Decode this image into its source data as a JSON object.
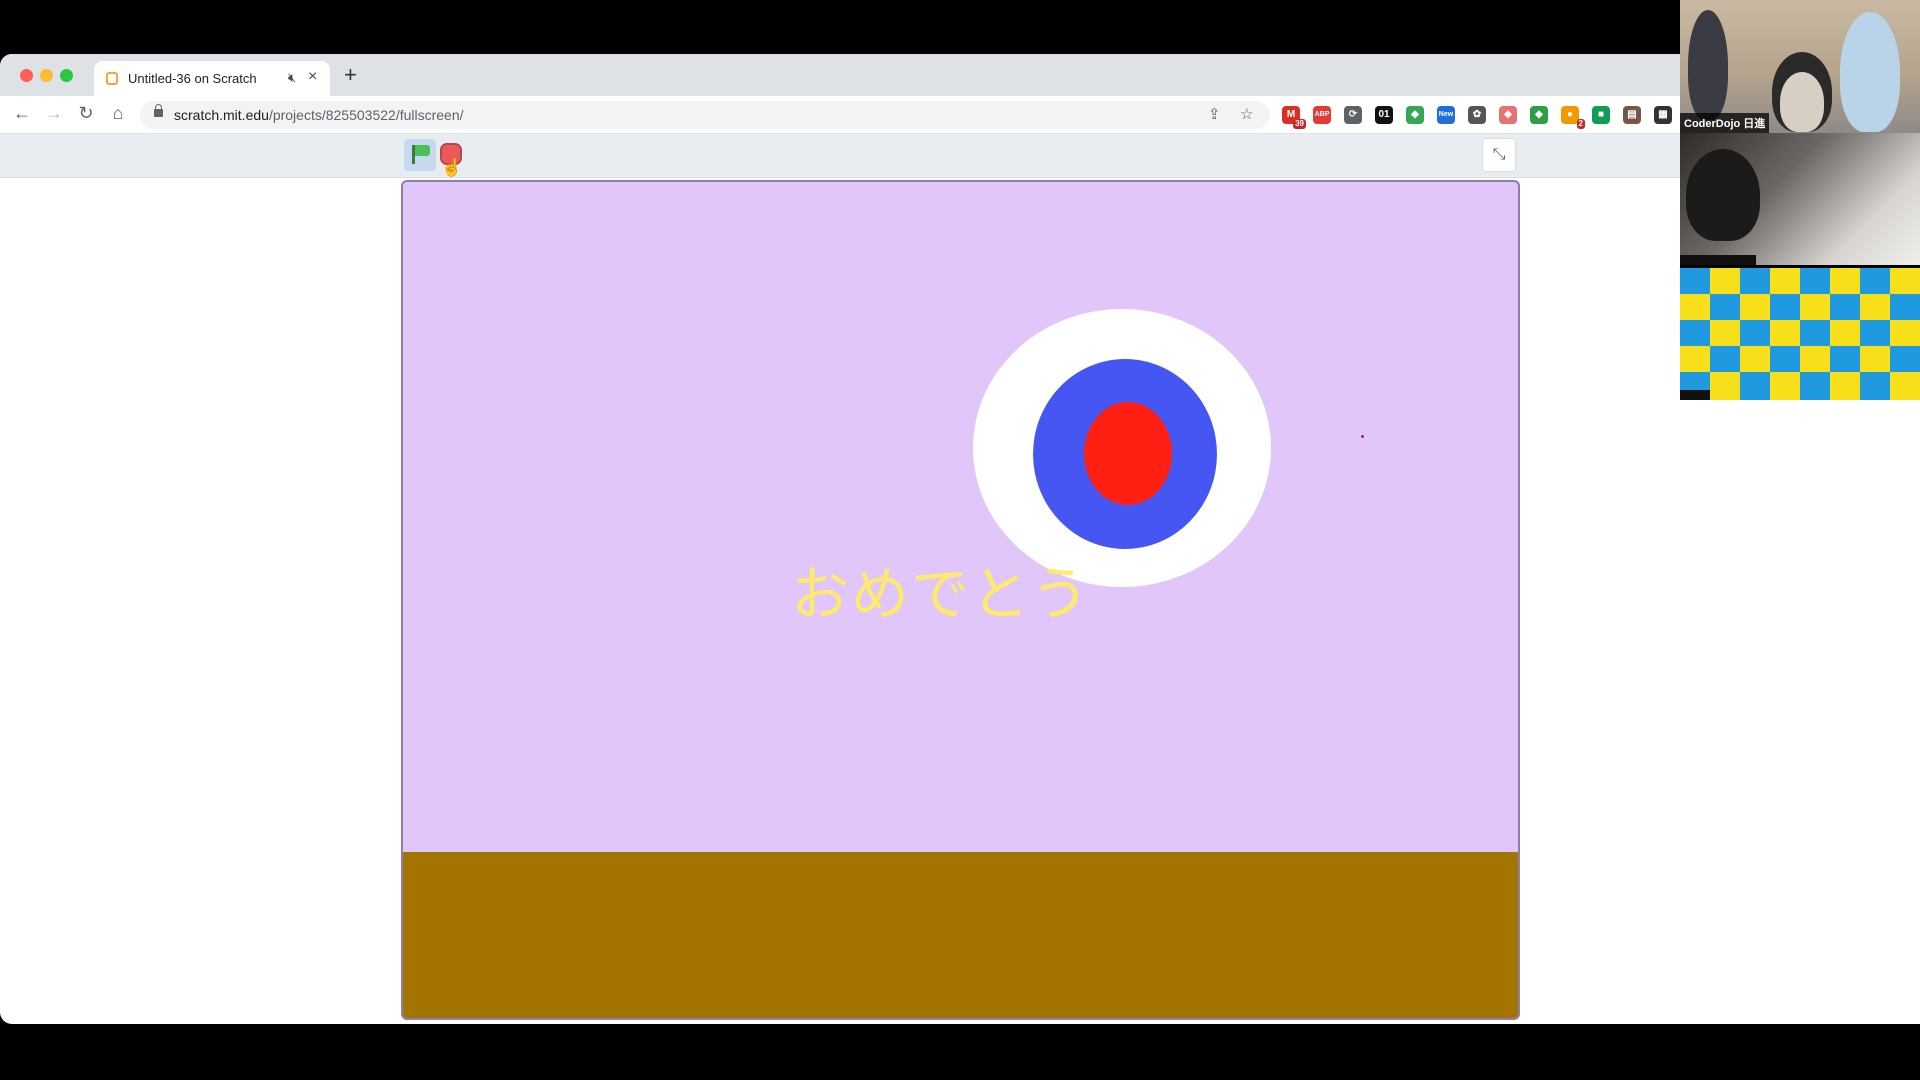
{
  "browser": {
    "tab": {
      "title": "Untitled-36 on Scratch",
      "audio_icon": "speaker-muted-icon",
      "close_glyph": "×"
    },
    "new_tab_glyph": "+",
    "address": {
      "host": "scratch.mit.edu",
      "path": "/projects/825503522/fullscreen/"
    },
    "extensions": [
      {
        "name": "gmail-icon",
        "label": "M",
        "color": "#d93025",
        "badge": "39"
      },
      {
        "name": "adblock-icon",
        "label": "ABP",
        "color": "#e53935"
      },
      {
        "name": "timer-icon",
        "label": "⟳",
        "color": "#5f6368"
      },
      {
        "name": "ext-01-icon",
        "label": "01",
        "color": "#111111"
      },
      {
        "name": "maps-icon",
        "label": "◆",
        "color": "#34a853"
      },
      {
        "name": "new-ext-icon",
        "label": "New",
        "color": "#1e6fd9"
      },
      {
        "name": "gear-ext-icon",
        "label": "✿",
        "color": "#555555"
      },
      {
        "name": "shield-ext-icon",
        "label": "◈",
        "color": "#e57373"
      },
      {
        "name": "diamond-ext-icon",
        "label": "◆",
        "color": "#2e9e44"
      },
      {
        "name": "ext-badge-icon",
        "label": "●",
        "color": "#f29900",
        "badge": "2"
      },
      {
        "name": "sheets-icon",
        "label": "■",
        "color": "#0f9d58"
      },
      {
        "name": "clipboard-ext-icon",
        "label": "▤",
        "color": "#795548"
      },
      {
        "name": "qr-ext-icon",
        "label": "▦",
        "color": "#333333"
      }
    ]
  },
  "scratch": {
    "stage_text": "おめでとう",
    "colors": {
      "sky": "#e1c6fa",
      "ground": "#a37400",
      "target_outer": "#ffffff",
      "target_mid": "#4656f2",
      "target_inner": "#ff1f13",
      "text": "#ffea6b"
    }
  },
  "video": {
    "participant_1_name": "CoderDojo 日進"
  }
}
